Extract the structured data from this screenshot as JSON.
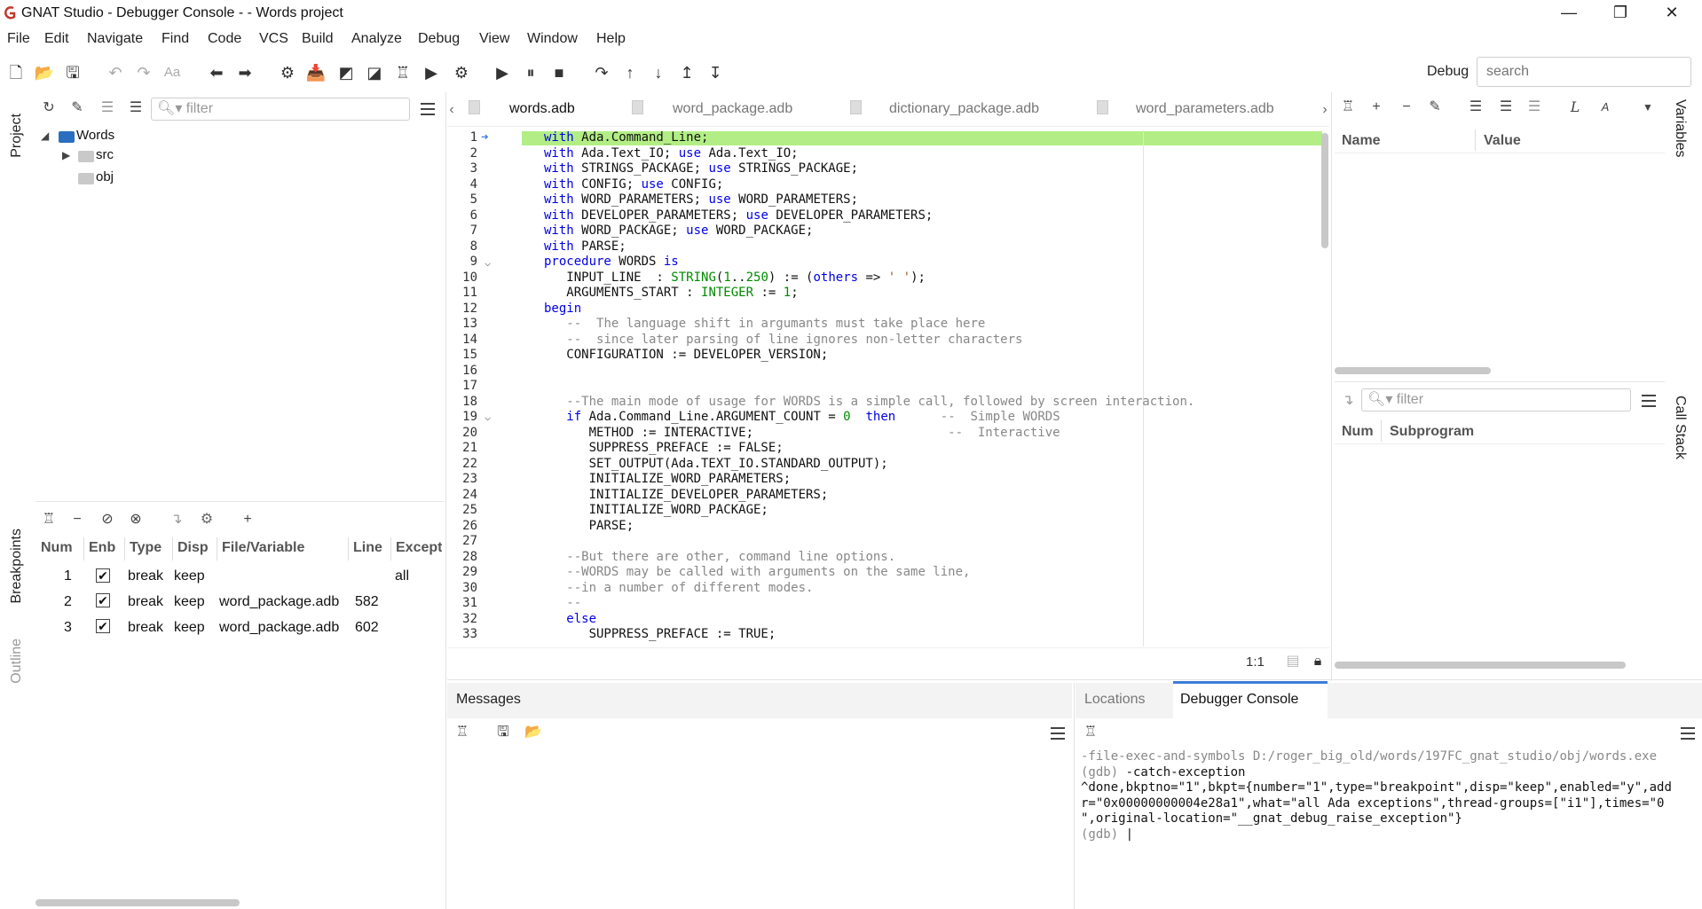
{
  "window": {
    "title": "GNAT Studio - Debugger Console -  - Words project",
    "controls": {
      "minimize": "—",
      "restore": "❐",
      "close": "✕"
    }
  },
  "menu": [
    "File",
    "Edit",
    "Navigate",
    "Find",
    "Code",
    "VCS",
    "Build",
    "Analyze",
    "Debug",
    "View",
    "Window",
    "Help"
  ],
  "toolbar": {
    "perspective_label": "Debug",
    "search_placeholder": "search"
  },
  "side_tabs": {
    "project": "Project",
    "breakpoints": "Breakpoints",
    "outline": "Outline",
    "variables": "Variables",
    "call_stack": "Call Stack"
  },
  "project": {
    "filter_placeholder": "filter",
    "root": "Words",
    "children": [
      "src",
      "obj"
    ]
  },
  "breakpoints": {
    "columns": [
      "Num",
      "Enb",
      "Type",
      "Disp",
      "File/Variable",
      "Line",
      "Excepti"
    ],
    "rows": [
      {
        "num": "1",
        "enabled": "✔",
        "type": "break",
        "disp": "keep",
        "file": "",
        "line": "",
        "exception": "all"
      },
      {
        "num": "2",
        "enabled": "✔",
        "type": "break",
        "disp": "keep",
        "file": "word_package.adb",
        "line": "582",
        "exception": ""
      },
      {
        "num": "3",
        "enabled": "✔",
        "type": "break",
        "disp": "keep",
        "file": "word_package.adb",
        "line": "602",
        "exception": ""
      }
    ]
  },
  "editor": {
    "tabs": [
      "words.adb",
      "word_package.adb",
      "dictionary_package.adb",
      "word_parameters.adb"
    ],
    "cursor_position": "1:1",
    "line_numbers": [
      "1",
      "2",
      "3",
      "4",
      "5",
      "6",
      "7",
      "8",
      "9",
      "10",
      "11",
      "12",
      "13",
      "14",
      "15",
      "16",
      "17",
      "18",
      "19",
      "20",
      "21",
      "22",
      "23",
      "24",
      "25",
      "26",
      "27",
      "28",
      "29",
      "30",
      "31",
      "32",
      "33"
    ]
  },
  "variables": {
    "columns": [
      "Name",
      "Value"
    ]
  },
  "call_stack": {
    "filter_placeholder": "filter",
    "columns": [
      "Num",
      "Subprogram"
    ]
  },
  "messages": {
    "title": "Messages"
  },
  "bottom_tabs": [
    "Locations",
    "Debugger Console"
  ],
  "console": {
    "lines": [
      {
        "cls": "gdb",
        "text": "-file-exec-and-symbols D:/roger_big_old/words/197FC_gnat_studio/obj/words.exe"
      },
      {
        "cls": "",
        "text": "-catch-exception",
        "prefix": "(gdb) "
      },
      {
        "cls": "",
        "text": "^done,bkptno=\"1\",bkpt={number=\"1\",type=\"breakpoint\",disp=\"keep\",enabled=\"y\",add"
      },
      {
        "cls": "",
        "text": "r=\"0x00000000004e28a1\",what=\"all Ada exceptions\",thread-groups=[\"i1\"],times=\"0"
      },
      {
        "cls": "",
        "text": "\",original-location=\"__gnat_debug_raise_exception\"}"
      },
      {
        "cls": "",
        "text": "|",
        "prefix": "(gdb) "
      }
    ]
  },
  "colors": {
    "current_line": "#b2ee85",
    "keyword": "#0000e6",
    "comment": "#888888",
    "active_tab_accent": "#3b7dd8",
    "folder": "#2a6fbf"
  }
}
